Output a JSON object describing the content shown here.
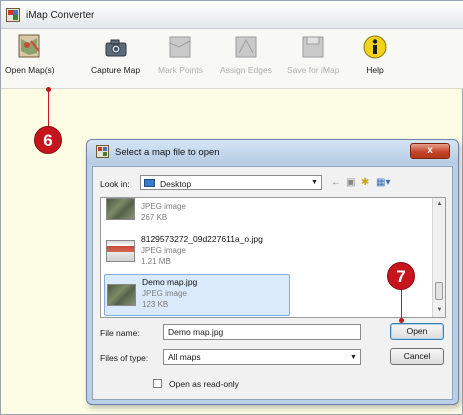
{
  "app": {
    "title": "iMap Converter"
  },
  "toolbar": {
    "items": [
      {
        "label": "Open Map(s)",
        "icon": "open-map-icon",
        "enabled": true
      },
      {
        "label": "Capture Map",
        "icon": "camera-icon",
        "enabled": true
      },
      {
        "label": "Mark Points",
        "icon": "mark-points-icon",
        "enabled": false
      },
      {
        "label": "Assign Edges",
        "icon": "assign-edges-icon",
        "enabled": false
      },
      {
        "label": "Save for iMap",
        "icon": "save-icon",
        "enabled": false
      },
      {
        "label": "Help",
        "icon": "info-icon",
        "enabled": true
      }
    ]
  },
  "callouts": {
    "step_open": "6",
    "step_confirm": "7"
  },
  "dialog": {
    "title": "Select a map file to open",
    "close_label": "x",
    "look_in_label": "Look in:",
    "look_in_value": "Desktop",
    "files": [
      {
        "name": "",
        "type": "JPEG image",
        "size": "267 KB",
        "thumbnail": "map"
      },
      {
        "name": "8129573272_09d227611a_o.jpg",
        "type": "JPEG image",
        "size": "1.21 MB",
        "thumbnail": "photo"
      },
      {
        "name": "Demo map.jpg",
        "type": "JPEG image",
        "size": "123 KB",
        "thumbnail": "map",
        "selected": true
      }
    ],
    "file_name_label": "File name:",
    "file_name_value": "Demo map.jpg",
    "files_of_type_label": "Files of type:",
    "files_of_type_value": "All maps",
    "open_button": "Open",
    "cancel_button": "Cancel",
    "read_only_label": "Open as read-only",
    "read_only_checked": false
  },
  "colors": {
    "callout": "#c4161c",
    "window_bg": "#fdfde6",
    "dialog_frame": "#b9d0e8",
    "selection": "#dbeafa"
  }
}
